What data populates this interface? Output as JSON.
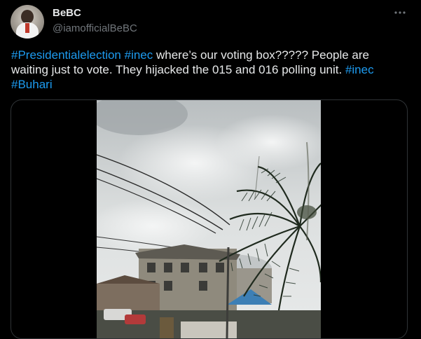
{
  "author": {
    "display_name": "BeBC",
    "handle": "@iamofficialBeBC",
    "avatar_icon": "profile-photo"
  },
  "tweet": {
    "segments": [
      {
        "type": "hashtag",
        "text": "#Presidentialelection"
      },
      {
        "type": "text",
        "text": " "
      },
      {
        "type": "hashtag",
        "text": "#inec"
      },
      {
        "type": "text",
        "text": " where’s our voting box????? People are waiting just to vote. They hijacked the 015 and 016 polling unit. "
      },
      {
        "type": "hashtag",
        "text": "#inec"
      },
      {
        "type": "text",
        "text": " "
      },
      {
        "type": "hashtag",
        "text": "#Buhari"
      }
    ]
  },
  "media": {
    "kind": "video",
    "icon": "video-thumbnail"
  },
  "more_icon": "ellipsis-icon",
  "colors": {
    "background": "#000000",
    "text": "#e7e9ea",
    "secondary": "#71767b",
    "link": "#1d9bf0",
    "border": "#2f3336"
  }
}
